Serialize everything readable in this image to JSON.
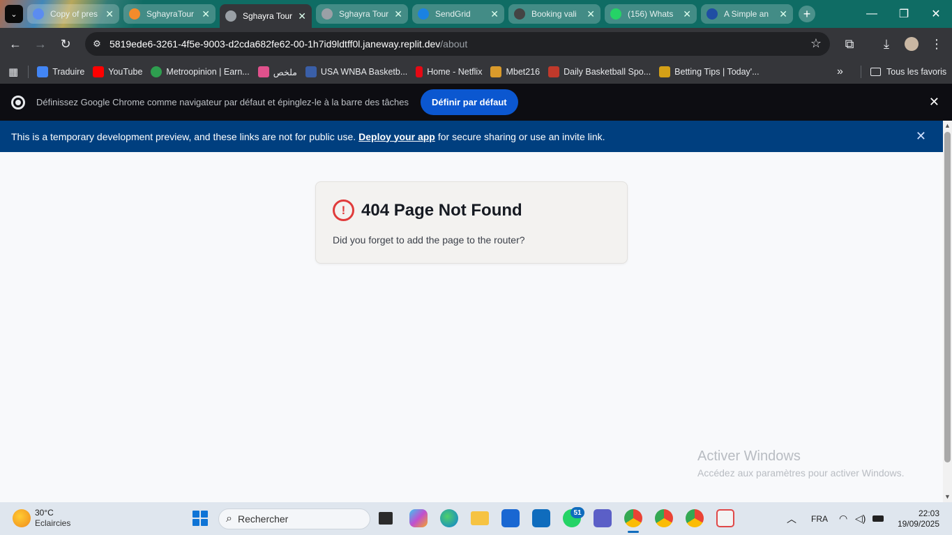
{
  "tabs": [
    {
      "title": "Copy of pres",
      "color": "#5b8cf0"
    },
    {
      "title": "SghayraTour",
      "color": "#f38b2b"
    },
    {
      "title": "Sghayra Tour",
      "color": "#9aa0a6"
    },
    {
      "title": "Sghayra Tour",
      "color": "#9aa0a6"
    },
    {
      "title": "SendGrid",
      "color": "#1a82e2"
    },
    {
      "title": "Booking vali",
      "color": "#444444"
    },
    {
      "title": "(156) Whats",
      "color": "#25d366"
    },
    {
      "title": "A Simple an",
      "color": "#1f4ea3"
    }
  ],
  "active_tab_index": 2,
  "window": {
    "minimize": "—",
    "restore": "❐",
    "close": "✕"
  },
  "toolbar": {
    "url_host": "5819ede6-3261-4f5e-9003-d2cda682fe62-00-1h7id9ldtff0l.janeway.replit.dev",
    "url_path": "/about"
  },
  "bookmarks": [
    {
      "label": "Traduire",
      "color": "#4285f4"
    },
    {
      "label": "YouTube",
      "color": "#ff0000"
    },
    {
      "label": "Metroopinion | Earn...",
      "color": "#2e9e4f"
    },
    {
      "label": "ملخص",
      "color": "#e0518c"
    },
    {
      "label": "USA WNBA Basketb...",
      "color": "#3a5fa8"
    },
    {
      "label": "Home - Netflix",
      "color": "#e50914"
    },
    {
      "label": "Mbet216",
      "color": "#d99a2b"
    },
    {
      "label": "Daily Basketball Spo...",
      "color": "#c0392b"
    },
    {
      "label": "Betting Tips | Today'...",
      "color": "#d4a017"
    }
  ],
  "bookmarks_overflow": "»",
  "all_bookmarks": "Tous les favoris",
  "infobar": {
    "message": "Définissez Google Chrome comme navigateur par défaut et épinglez-le à la barre des tâches",
    "button": "Définir par défaut"
  },
  "dev_banner": {
    "text_before": "This is a temporary development preview, and these links are not for public use.",
    "link": "Deploy your app",
    "text_after": "for secure sharing or use an invite link."
  },
  "not_found": {
    "title": "404 Page Not Found",
    "message": "Did you forget to add the page to the router?"
  },
  "watermark": {
    "title": "Activer Windows",
    "subtitle": "Accédez aux paramètres pour activer Windows."
  },
  "taskbar": {
    "temperature": "30°C",
    "condition": "Eclaircies",
    "search_placeholder": "Rechercher",
    "whatsapp_badge": "51",
    "language": "FRA",
    "time": "22:03",
    "date": "19/09/2025"
  }
}
